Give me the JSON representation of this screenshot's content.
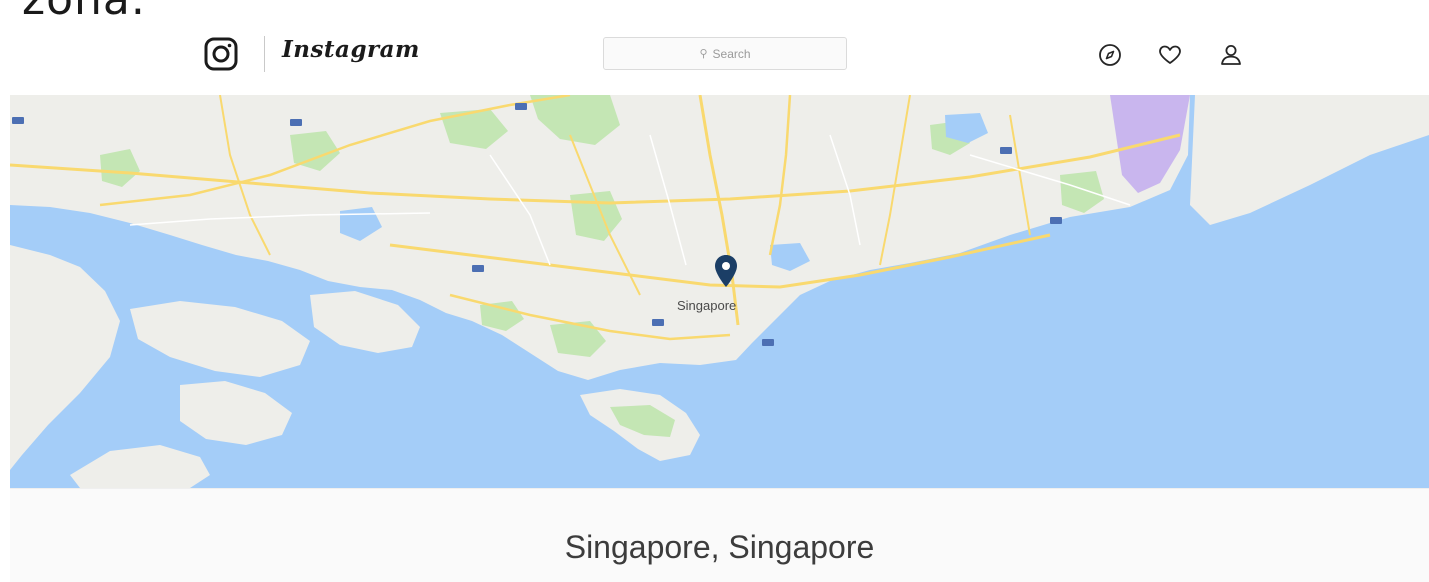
{
  "caption": "zona.",
  "header": {
    "brand": "Instagram",
    "search_placeholder": "Search",
    "icons": {
      "logo": "camera-icon",
      "search": "magnifier-icon",
      "explore": "compass-icon",
      "activity": "heart-icon",
      "profile": "person-icon"
    }
  },
  "map": {
    "city_label": "Singapore",
    "pin_icon": "location-pin-icon",
    "pin_color": "#1b3e66",
    "water_color": "#a4cdf8",
    "land_color": "#eeeeea",
    "park_color": "#c4e6b4",
    "road_color": "#f9d96f",
    "airport_color": "#c9b6ee"
  },
  "location": {
    "title": "Singapore, Singapore"
  }
}
